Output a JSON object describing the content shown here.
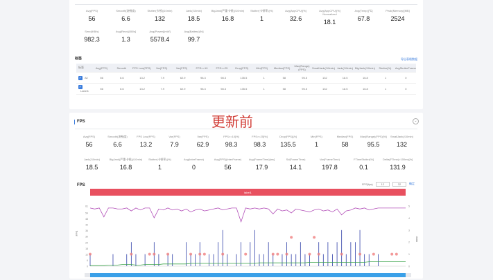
{
  "summary_top": {
    "row1": [
      {
        "label": "Avg(FPS)",
        "value": "56"
      },
      {
        "label": "Smooth(流畅度)",
        "value": "6.6"
      },
      {
        "label": "Stutter(卡顿)(10min)",
        "value": "132"
      },
      {
        "label": "Jank(/10min)",
        "value": "18.5"
      },
      {
        "label": "BigJank(严重卡顿)(/10min)",
        "value": "16.8"
      },
      {
        "label": "Stutter(卡顿率)(%)",
        "value": "1"
      },
      {
        "label": "Avg(AppCPU)[%]",
        "value": "32.6"
      },
      {
        "label": "Avg(AppCPU)[%] Normalized",
        "value": "18.1"
      },
      {
        "label": "Avg(Temp)[℃]",
        "value": "67.8"
      },
      {
        "label": "Peak(Memory)[MB]",
        "value": "2524"
      }
    ],
    "row2": [
      {
        "label": "Send(KB/s)",
        "value": "982.3"
      },
      {
        "label": "Avg(Recv)[KB/s]",
        "value": "1.3"
      },
      {
        "label": "Avg(Power)[mW]",
        "value": "5578.4"
      },
      {
        "label": "Avg(Battery)[%]",
        "value": "99.7"
      }
    ]
  },
  "table": {
    "title": "标签",
    "link": "导出表格数据",
    "headers": [
      "标签",
      "Avg(FPS)",
      "Smooth",
      "FPS Low(FPS)",
      "Var(FPS)",
      "Var(FPS)",
      "FPS>=10",
      "FPS>=25",
      "Drop(FPS)",
      "Min(FPS)",
      "Median(FPS)",
      "Max(Range)(FPS)",
      "SmallJank(/10min)",
      "Jank(/10min)",
      "BigJank(/10min)",
      "Stutter(%)",
      "AvgStutterFrame"
    ],
    "rows": [
      {
        "checked": true,
        "cells": [
          "All",
          "56",
          "6.6",
          "13.2",
          "7.9",
          "62.9",
          "98.3",
          "98.3",
          "135.5",
          "1",
          "58",
          "95.5",
          "132",
          "18.5",
          "16.8",
          "1",
          "0"
        ]
      },
      {
        "checked": true,
        "cells": [
          "Label1",
          "56",
          "6.6",
          "13.2",
          "7.9",
          "62.9",
          "98.3",
          "98.3",
          "135.5",
          "1",
          "58",
          "95.5",
          "132",
          "18.5",
          "16.8",
          "1",
          "0"
        ]
      }
    ]
  },
  "stamp": "更新前",
  "fps_section": {
    "title": "FPS",
    "collapse_icon": "chevron-down-icon",
    "row1": [
      {
        "label": "Avg(FPS)",
        "value": "56"
      },
      {
        "label": "Smooth(流畅度)",
        "value": "6.6"
      },
      {
        "label": "FPS Low(FPS)",
        "value": "13.2"
      },
      {
        "label": "Var(FPS)",
        "value": "7.9"
      },
      {
        "label": "Var(FPS)",
        "value": "62.9"
      },
      {
        "label": "FPS>=10[%]",
        "value": "98.3"
      },
      {
        "label": "FPS>=25[%]",
        "value": "98.3"
      },
      {
        "label": "Drop(FPS)[/h]",
        "value": "135.5"
      },
      {
        "label": "Min(FPS)",
        "value": "1"
      },
      {
        "label": "Median(FPS)",
        "value": "58"
      },
      {
        "label": "Max(Range)(FPS)[%]",
        "value": "95.5"
      },
      {
        "label": "SmallJank(/10min)",
        "value": "132"
      }
    ],
    "row2": [
      {
        "label": "Jank(/10min)",
        "value": "18.5"
      },
      {
        "label": "BigJank(严重卡顿)(/10min)",
        "value": "16.8"
      },
      {
        "label": "Stutter(卡顿率)(%)",
        "value": "1"
      },
      {
        "label": "Avg(InterFrame)",
        "value": "0"
      },
      {
        "label": "Avg(FPS)(InterFrame)",
        "value": "56"
      },
      {
        "label": "Avg(FrameTime)[ms]",
        "value": "17.9"
      },
      {
        "label": "Sd(FrameTime)",
        "value": "14.1"
      },
      {
        "label": "Var(FrameTime)",
        "value": "197.8"
      },
      {
        "label": "FTimeStutter[%]",
        "value": "0.1"
      },
      {
        "label": "Delta(FTime)>100ms[/h]",
        "value": "131.9"
      }
    ],
    "chart_title": "FPS",
    "controls": {
      "label": "FPS(fps)",
      "min": "12",
      "max": "32",
      "apply": "确定"
    },
    "label_bar": "label1"
  },
  "chart_data": {
    "type": "line",
    "ylabel": "FPS",
    "y2label": "Jank",
    "ylim": [
      0,
      61
    ],
    "y2lim": [
      0,
      5
    ],
    "yticks": [
      0,
      6,
      12,
      18,
      24,
      30,
      36,
      42,
      48,
      54,
      61
    ],
    "y2ticks": [
      0,
      1,
      2,
      3,
      4,
      5
    ],
    "grid": false,
    "colors": {
      "fps": "#b24fb8",
      "jank": "#2f3fa8",
      "frametime": "#3aa34a",
      "label_bar": "#e8505f",
      "marker": "#f08080"
    },
    "series": [
      {
        "key": "fps",
        "values": [
          59,
          58,
          59,
          50,
          59,
          59,
          58,
          58,
          59,
          56,
          59,
          57,
          59,
          59,
          49,
          58,
          57,
          59,
          57,
          58,
          56,
          58,
          55,
          57,
          58,
          56,
          57,
          58,
          59,
          57,
          58,
          59,
          59,
          45,
          59,
          58,
          59,
          58,
          59,
          58,
          53,
          58,
          56,
          57,
          54,
          58,
          57,
          56,
          55,
          57,
          58,
          56,
          57,
          55,
          58,
          52,
          56,
          57,
          59,
          58,
          59,
          57,
          58,
          59,
          59,
          59,
          59,
          59,
          59,
          59
        ]
      },
      {
        "key": "jank",
        "values": [
          1,
          0,
          0,
          0,
          0,
          1,
          0,
          0,
          1,
          2,
          1,
          0,
          1,
          0,
          2,
          1,
          0,
          1,
          1,
          0,
          0,
          2,
          1,
          1,
          2,
          0,
          1,
          1,
          2,
          3,
          1,
          0,
          1,
          2,
          0,
          2,
          3,
          1,
          1,
          2,
          1,
          0,
          1,
          2,
          1,
          1,
          2,
          1,
          1,
          0,
          2,
          1,
          2,
          1,
          2,
          3,
          1,
          2,
          2,
          3,
          1,
          1,
          0,
          1,
          0,
          0,
          0,
          0,
          0,
          0
        ]
      },
      {
        "key": "frametime",
        "values": [
          1,
          1,
          1,
          1,
          2,
          2,
          2,
          3,
          3,
          3,
          2,
          2,
          3,
          3,
          3,
          3,
          4,
          4,
          4,
          4,
          4,
          4,
          5,
          5,
          5,
          5,
          5,
          5,
          5,
          5,
          5,
          5,
          5,
          5,
          5,
          5,
          5,
          6,
          6,
          6,
          6,
          6,
          6,
          6,
          6,
          6,
          6,
          6,
          7,
          7,
          7,
          7,
          7,
          7,
          7,
          7,
          7,
          7,
          7,
          7,
          7,
          8,
          8,
          8,
          8,
          8,
          8,
          8,
          8,
          8
        ]
      }
    ],
    "jank_markers": [
      [
        0,
        1
      ],
      [
        9,
        1
      ],
      [
        13,
        1
      ],
      [
        14,
        1
      ],
      [
        17,
        1
      ],
      [
        22,
        1
      ],
      [
        24,
        1
      ],
      [
        25,
        1
      ],
      [
        29,
        1
      ],
      [
        34,
        1
      ],
      [
        40,
        1
      ],
      [
        41,
        1
      ],
      [
        43,
        1
      ],
      [
        44,
        2.4
      ],
      [
        48,
        1
      ],
      [
        49,
        2.4
      ],
      [
        50,
        1
      ],
      [
        55,
        1
      ],
      [
        59,
        1
      ],
      [
        62,
        1
      ],
      [
        66,
        1
      ],
      [
        67,
        1
      ]
    ]
  }
}
